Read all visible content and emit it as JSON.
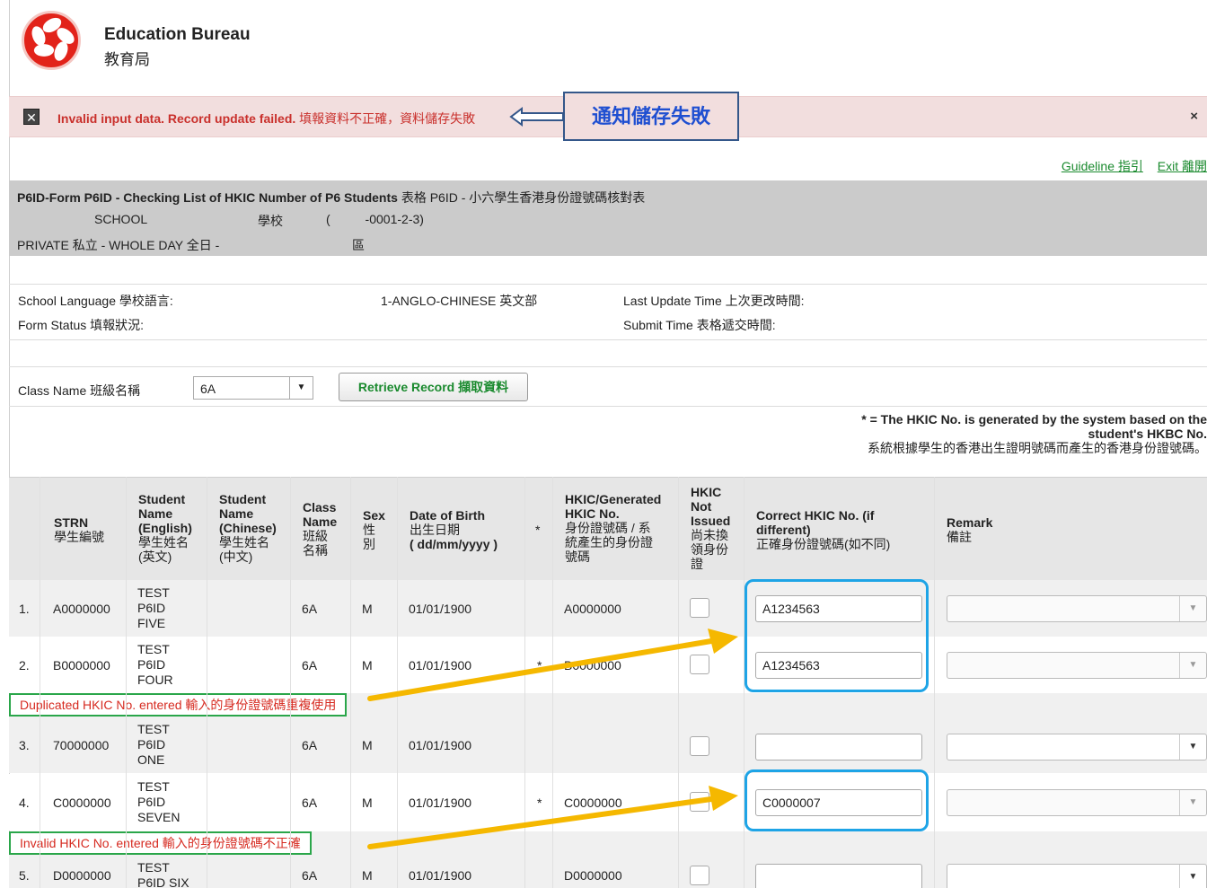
{
  "header": {
    "org_en": "Education Bureau",
    "org_zh": "教育局"
  },
  "alert": {
    "message_en": "Invalid input data. Record update failed.",
    "message_zh": "填報資料不正確，資料儲存失敗",
    "close_label": "×",
    "annotation": "通知儲存失敗",
    "error_icon": "x-box-icon"
  },
  "links": {
    "guideline": "Guideline 指引",
    "exit": "Exit 離開"
  },
  "form": {
    "title_en": "P6ID-Form P6ID - Checking List of HKIC Number of P6 Students",
    "title_zh": "表格 P6ID - 小六學生香港身份證號碼核對表",
    "school_label_en": "SCHOOL",
    "school_label_zh": "學校",
    "school_code": "(          -0001-2-3)",
    "school_type": "PRIVATE 私立 - WHOLE DAY 全日 -",
    "district_zh": "區"
  },
  "info": {
    "language_label": "School Language 學校語言:",
    "language_value": "1-ANGLO-CHINESE 英文部",
    "last_update_label": "Last Update Time 上次更改時間:",
    "status_label": "Form Status 填報狀況:",
    "submit_label": "Submit Time 表格遞交時間:"
  },
  "class_select": {
    "label": "Class Name 班級名稱",
    "value": "6A",
    "button": "Retrieve Record 擷取資料"
  },
  "note": {
    "line1": "* = The HKIC No. is generated by the system based on the",
    "line2": "student's HKBC No.",
    "line3": "系統根據學生的香港出生證明號碼而產生的香港身份證號碼。"
  },
  "columns": {
    "strn": [
      "STRN",
      "學生編號"
    ],
    "name_en": [
      "Student",
      "Name",
      "(English)",
      "學生姓名",
      "(英文)"
    ],
    "name_zh": [
      "Student",
      "Name",
      "(Chinese)",
      "學生姓名",
      "(中文)"
    ],
    "class": [
      "Class",
      "Name",
      "班級",
      "名稱"
    ],
    "sex": [
      "Sex",
      "性",
      "別"
    ],
    "dob": [
      "Date of Birth",
      "出生日期",
      "( dd/mm/yyyy )"
    ],
    "star": "*",
    "hkic": [
      "HKIC/Generated",
      "HKIC No.",
      "身份證號碼 / 系",
      "統產生的身份證",
      "號碼"
    ],
    "not_issued": [
      "HKIC",
      "Not",
      "Issued",
      "尚未換",
      "領身份",
      "證"
    ],
    "correct": [
      "Correct HKIC No. (if",
      "different)",
      "正確身份證號碼(如不同)"
    ],
    "remark": [
      "Remark",
      "備註"
    ]
  },
  "rows": [
    {
      "no": "1.",
      "strn": "A0000000",
      "name": [
        "TEST",
        "P6ID",
        "FIVE"
      ],
      "class": "6A",
      "sex": "M",
      "dob": "01/01/1900",
      "star": "",
      "hkic": "A0000000",
      "correct": "A1234563",
      "remark_enabled": false
    },
    {
      "no": "2.",
      "strn": "B0000000",
      "name": [
        "TEST",
        "P6ID",
        "FOUR"
      ],
      "class": "6A",
      "sex": "M",
      "dob": "01/01/1900",
      "star": "*",
      "hkic": "B0000000",
      "correct": "A1234563",
      "remark_enabled": false
    },
    {
      "no": "3.",
      "strn": "70000000",
      "name": [
        "TEST",
        "P6ID",
        "ONE"
      ],
      "class": "6A",
      "sex": "M",
      "dob": "01/01/1900",
      "star": "",
      "hkic": "",
      "correct": "",
      "remark_enabled": true
    },
    {
      "no": "4.",
      "strn": "C0000000",
      "name": [
        "TEST",
        "P6ID",
        "SEVEN"
      ],
      "class": "6A",
      "sex": "M",
      "dob": "01/01/1900",
      "star": "*",
      "hkic": "C0000000",
      "correct": "C0000007",
      "remark_enabled": false
    },
    {
      "no": "5.",
      "strn": "D0000000",
      "name": [
        "TEST",
        "P6ID SIX"
      ],
      "class": "6A",
      "sex": "M",
      "dob": "01/01/1900",
      "star": "",
      "hkic": "D0000000",
      "correct": "",
      "remark_enabled": true
    }
  ],
  "row_errors": {
    "duplicate": "Duplicated HKIC No. entered 輸入的身份證號碼重複使用",
    "invalid": "Invalid HKIC No. entered 輸入的身份證號碼不正確"
  },
  "colors": {
    "alert_bg": "#f2dede",
    "error_text": "#d62a20",
    "link": "#1a8a2e",
    "highlight_box": "#1ea4e6",
    "arrow": "#f5b800",
    "label_border": "#2aa64a"
  }
}
